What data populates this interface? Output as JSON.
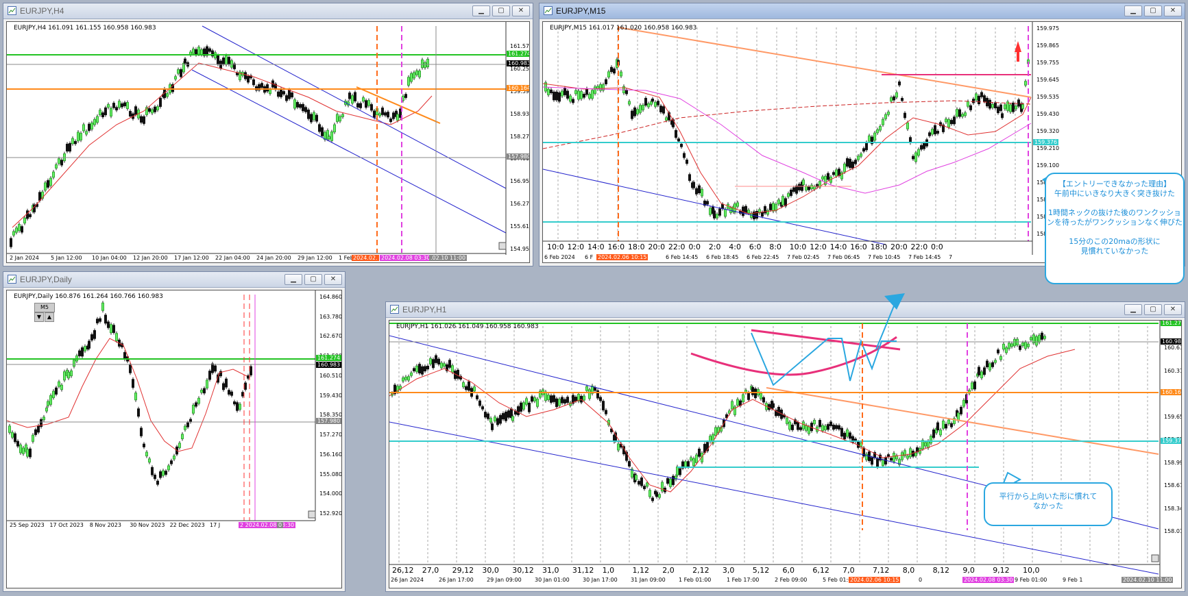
{
  "windows": {
    "h4": {
      "title": "EURJPY,H4",
      "info": "EURJPY,H4  161.091 161.155 160.958 160.983",
      "price_labels": [
        "161.570",
        "160.250",
        "159.590",
        "158.930",
        "158.270",
        "157.610",
        "156.950",
        "156.275",
        "155.615",
        "154.955"
      ],
      "tag_green": "161.274",
      "tag_current": "160.983",
      "tag_orange": "160.164",
      "tag_gray": "157.980",
      "time_labels": [
        "2 Jan 2024",
        "5 Jan 12:00",
        "10 Jan 04:00",
        "12 Jan 20:00",
        "17 Jan 12:00",
        "22 Jan 04:00",
        "24 Jan 20:00",
        "29 Jan 12:00",
        "1 Feb 04"
      ],
      "time_tag_orange": "2024.02.",
      "time_tag_magenta": "2024.02.08 03:30",
      "time_tag_gray": ".02.10 11:00"
    },
    "m15": {
      "title": "EURJPY,M15",
      "info": "EURJPY,M15  161.017 161.020 160.958 160.983",
      "price_labels": [
        "159.975",
        "159.865",
        "159.755",
        "159.645",
        "159.535",
        "159.430",
        "159.320",
        "159.210",
        "159.100",
        "158.990",
        "158.880",
        "158.770",
        "158.660"
      ],
      "tag_cyan": "159.376",
      "hour_labels": [
        "10:0",
        "12:0",
        "14:0",
        "16:0",
        "18:0",
        "20:0",
        "22:0",
        "0:0",
        "2:0",
        "4:0",
        "6:0",
        "8:0",
        "10:0",
        "12:0",
        "14:0",
        "16:0",
        "18:0",
        "20:0",
        "22:0",
        "0:0"
      ],
      "time_labels": [
        "6 Feb 2024",
        "6 F",
        "0:45",
        "6 Feb 14:45",
        "6 Feb 18:45",
        "6 Feb 22:45",
        "7 Feb 02:45",
        "7 Feb 06:45",
        "7 Feb 10:45",
        "7 Feb 14:45",
        "7"
      ],
      "time_tag_orange": "2024.02.06 10:15"
    },
    "daily": {
      "title": "EURJPY,Daily",
      "info": "EURJPY,Daily  160.876 161.264 160.766 160.983",
      "tf_button": "M5",
      "price_labels": [
        "164.860",
        "163.780",
        "162.670",
        "161.590",
        "160.510",
        "159.430",
        "158.350",
        "157.270",
        "156.160",
        "155.080",
        "154.000",
        "152.920"
      ],
      "tag_green": "161.274",
      "tag_current": "160.983",
      "tag_gray": "157.980",
      "time_labels": [
        "25 Sep 2023",
        "17 Oct 2023",
        "8 Nov 2023",
        "30 Nov 2023",
        "22 Dec 2023",
        "17 J"
      ],
      "time_tag_magenta": "2 2024.02.08 03:30",
      "time_tag_gray": "0"
    },
    "h1": {
      "title": "EURJPY,H1",
      "info": "EURJPY,H1  161.026 161.049 160.958 160.983",
      "price_labels": [
        "160.610",
        "160.310",
        "159.990",
        "159.650",
        "159.325",
        "158.990",
        "158.670",
        "158.340",
        "158.010"
      ],
      "tag_green": "161.274",
      "tag_current": "160.983",
      "tag_orange": "160.164",
      "tag_cyan": "159.376",
      "day_labels": [
        "26,12",
        "27,0",
        "29,12",
        "30,0",
        "30,12",
        "31,0",
        "31,12",
        "1,0",
        "1,12",
        "2,0",
        "2,12",
        "3,0",
        "5,12",
        "6,0",
        "6,12",
        "7,0",
        "7,12",
        "8,0",
        "8,12",
        "9,0",
        "9,12",
        "10,0"
      ],
      "time_labels": [
        "26 Jan 2024",
        "26 Jan 17:00",
        "29 Jan 09:00",
        "30 Jan 01:00",
        "30 Jan 17:00",
        "31 Jan 09:00",
        "1 Feb 01:00",
        "1 Feb 17:00",
        "2 Feb 09:00",
        "5 Feb 01:00",
        "5 Feb",
        "0",
        "7 Feb 01:00",
        "9 Feb 01:00",
        "9 Feb 1"
      ],
      "time_tag_orange": "2024.02.06 10:15",
      "time_tag_magenta": "2024.02.08 03:30",
      "time_tag_gray": "2024.02.10 11:00"
    }
  },
  "callouts": {
    "m15_note": {
      "lines": [
        "【エントリーできなかった理由】",
        "午前中にいきなり大きく突き抜けた",
        "",
        "1時間ネックの抜けた後のワンクッショ",
        "ンを待ったがワンクッションなく伸びた",
        "",
        "15分のこの20maの形状に",
        "見慣れていなかった"
      ]
    },
    "h1_note": {
      "lines": [
        "平行から上向いた形に慣れて",
        "なかった"
      ]
    }
  },
  "colors": {
    "green_level": "#22c322",
    "orange_level": "#ff8a1a",
    "cyan_level": "#33cccc",
    "channel": "#2222cc",
    "ma_red": "#e03030",
    "magenta": "#e040e0",
    "pink": "#e8307a",
    "bull": "#66ee66",
    "bear": "#111111"
  }
}
